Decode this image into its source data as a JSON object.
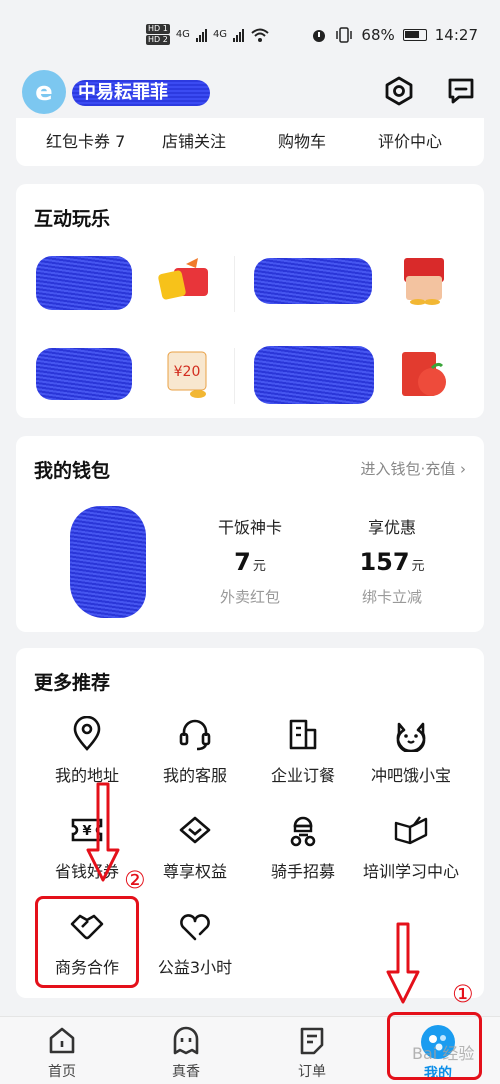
{
  "status_bar": {
    "hd1": "HD 1",
    "hd2": "HD 2",
    "net1": "4G",
    "net2": "4G",
    "battery": "68%",
    "time": "14:27"
  },
  "header": {
    "user_name": "中易耘罪菲",
    "settings_icon": "hexagon-settings-icon",
    "message_icon": "message-icon"
  },
  "shortcuts": {
    "items": [
      "红包卡券 7",
      "店铺关注",
      "购物车",
      "评价中心"
    ]
  },
  "interactive": {
    "title": "互动玩乐"
  },
  "wallet": {
    "title": "我的钱包",
    "link": "进入钱包·充值",
    "chevron": "›",
    "cards": [
      {
        "label": "干饭神卡",
        "value": "7",
        "unit": "元",
        "sub": "外卖红包"
      },
      {
        "label": "享优惠",
        "value": "157",
        "unit": "元",
        "sub": "绑卡立减"
      }
    ]
  },
  "more": {
    "title": "更多推荐",
    "items": [
      {
        "label": "我的地址",
        "icon": "location-icon"
      },
      {
        "label": "我的客服",
        "icon": "headset-icon"
      },
      {
        "label": "企业订餐",
        "icon": "building-icon"
      },
      {
        "label": "冲吧饿小宝",
        "icon": "cat-face-icon"
      },
      {
        "label": "省钱好券",
        "icon": "coupon-icon"
      },
      {
        "label": "尊享权益",
        "icon": "diamond-icon"
      },
      {
        "label": "骑手招募",
        "icon": "rider-icon"
      },
      {
        "label": "培训学习中心",
        "icon": "book-icon"
      },
      {
        "label": "商务合作",
        "icon": "handshake-icon"
      },
      {
        "label": "公益3小时",
        "icon": "heart-icon"
      }
    ]
  },
  "nav": {
    "items": [
      "首页",
      "真香",
      "订单",
      "我的"
    ]
  },
  "annotations": {
    "num1": "①",
    "num2": "②",
    "watermark": "Bai 经验"
  },
  "colors": {
    "accent": "#1a9cf0",
    "annotation": "#e4101a"
  }
}
